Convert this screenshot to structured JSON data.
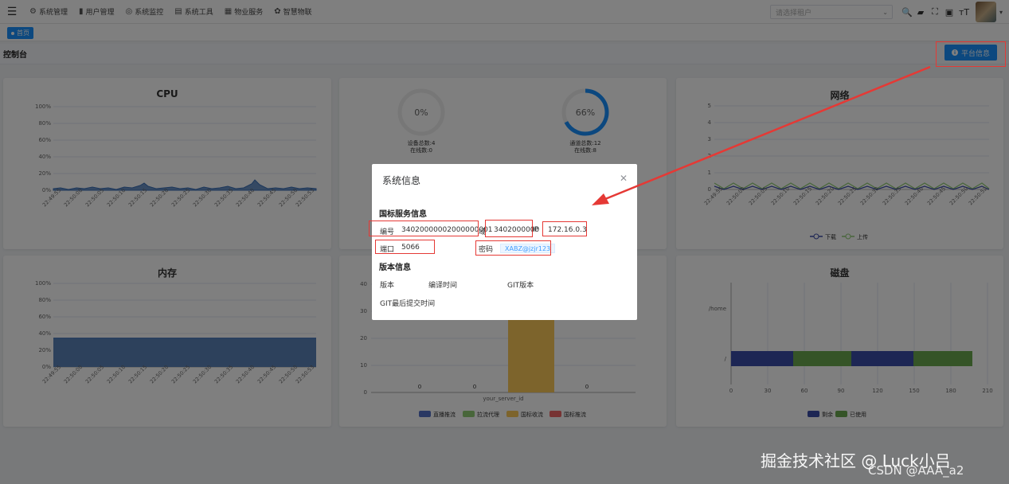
{
  "nav": {
    "menu": [
      {
        "label": "系统管理",
        "icon": "gear-icon",
        "glyph": "⚙"
      },
      {
        "label": "用户管理",
        "icon": "bar-icon",
        "glyph": "▮"
      },
      {
        "label": "系统监控",
        "icon": "monitor-icon",
        "glyph": "◎"
      },
      {
        "label": "系统工具",
        "icon": "tool-icon",
        "glyph": "▤"
      },
      {
        "label": "物业服务",
        "icon": "building-icon",
        "glyph": "▦"
      },
      {
        "label": "智慧物联",
        "icon": "iot-icon",
        "glyph": "✿"
      }
    ],
    "tenant_placeholder": "请选择租户"
  },
  "tags": {
    "home": "首页"
  },
  "console": {
    "title": "控制台",
    "info_button": "平台信息"
  },
  "cpu": {
    "title": "CPU",
    "y_ticks": [
      "100%",
      "80%",
      "60%",
      "40%",
      "20%",
      "0%"
    ],
    "x_ticks": [
      "22:49:55",
      "22:50:00",
      "22:50:05",
      "22:50:10",
      "22:50:15",
      "22:50:20",
      "22:50:25",
      "22:50:30",
      "22:50:35",
      "22:50:40",
      "22:50:45",
      "22:50:50",
      "22:50:53"
    ]
  },
  "devices": {
    "device_pct": "0%",
    "device_total": "设备总数:4",
    "device_online": "在线数:0",
    "channel_pct": "66%",
    "channel_total": "通道总数:12",
    "channel_online": "在线数:8"
  },
  "network": {
    "title": "网络",
    "y_ticks": [
      "5",
      "4",
      "3",
      "2",
      "1",
      "0"
    ],
    "x_ticks": [
      "22:49:55",
      "22:50:00",
      "22:50:05",
      "22:50:10",
      "22:50:15",
      "22:50:20",
      "22:50:25",
      "22:50:30",
      "22:50:35",
      "22:50:40",
      "22:50:45",
      "22:50:50",
      "22:50:52"
    ],
    "legend": [
      "下载",
      "上传"
    ],
    "colors": [
      "#3b4ca8",
      "#91cc75"
    ]
  },
  "memory": {
    "title": "内存",
    "y_ticks": [
      "100%",
      "80%",
      "60%",
      "40%",
      "20%",
      "0%"
    ],
    "x_ticks": [
      "22:49:55",
      "22:50:00",
      "22:50:05",
      "22:50:10",
      "22:50:15",
      "22:50:20",
      "22:50:25",
      "22:50:30",
      "22:50:35",
      "22:50:40",
      "22:50:45",
      "22:50:50",
      "22:50:53"
    ]
  },
  "media": {
    "y_ticks": [
      "40",
      "30",
      "20",
      "10",
      "0"
    ],
    "values": [
      "0",
      "0",
      "0"
    ],
    "category": "your_server_id",
    "legend": [
      "直播推流",
      "拉流代理",
      "国标收流",
      "国标推流"
    ],
    "colors": [
      "#5470c6",
      "#91cc75",
      "#fac858",
      "#ee6666"
    ]
  },
  "disk": {
    "title": "磁盘",
    "categories": [
      "/home",
      "/"
    ],
    "x_ticks": [
      "0",
      "30",
      "60",
      "90",
      "120",
      "150",
      "180",
      "210"
    ],
    "legend": [
      "剩余",
      "已使用"
    ],
    "colors": [
      "#3b4ca8",
      "#6aa84f"
    ]
  },
  "modal": {
    "title": "系统信息",
    "gb_section": "国标服务信息",
    "id_label": "编号",
    "id_value": "34020000002000000001",
    "domain_label": "域",
    "domain_value": "3402000000",
    "ip_label": "IP",
    "ip_value": "172.16.0.3",
    "port_label": "端口",
    "port_value": "5066",
    "pwd_label": "密码",
    "pwd_value": "XABZ@jzjr123",
    "version_section": "版本信息",
    "version_label": "版本",
    "build_label": "编译时间",
    "git_label": "GIT版本",
    "git_commit_label": "GIT最后提交时间"
  },
  "watermark": {
    "text": "掘金技术社区 @ Luck小吕",
    "csdn": "CSDN @AAA_a2"
  }
}
